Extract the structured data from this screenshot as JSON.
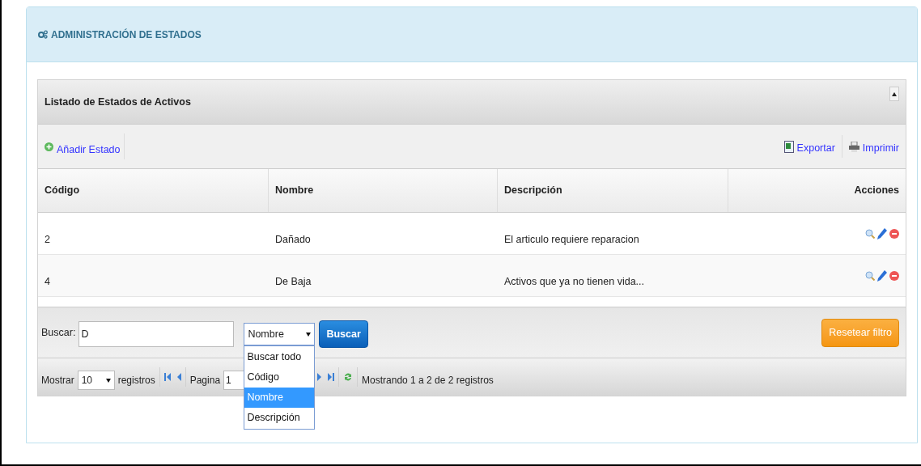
{
  "page": {
    "title": "ADMINISTRACIÓN DE ESTADOS"
  },
  "grid": {
    "caption": "Listado de Estados de Activos",
    "add": "Añadir Estado",
    "export": "Exportar",
    "print": "Imprimir",
    "columns": [
      "Código",
      "Nombre",
      "Descripción",
      "Acciones"
    ],
    "rows": [
      {
        "cells": [
          "2",
          "Dañado",
          "El articulo requiere reparacion"
        ]
      },
      {
        "cells": [
          "4",
          "De Baja",
          "Activos que ya no tienen vida..."
        ]
      }
    ]
  },
  "search": {
    "label": "Buscar:",
    "value": "D",
    "select": {
      "value": "Nombre",
      "expanded": true,
      "options": [
        {
          "label": "Buscar todo",
          "selected": false
        },
        {
          "label": "Código",
          "selected": false
        },
        {
          "label": "Nombre",
          "selected": true
        },
        {
          "label": "Descripción",
          "selected": false
        }
      ]
    },
    "button": "Buscar",
    "reset": "Resetear filtro"
  },
  "pager": {
    "show_label": "Mostrar",
    "page_size": "10",
    "records_label": "registros",
    "page_label": "Pagina",
    "page": "1",
    "info": "Mostrando 1 a 2 de 2 registros"
  }
}
